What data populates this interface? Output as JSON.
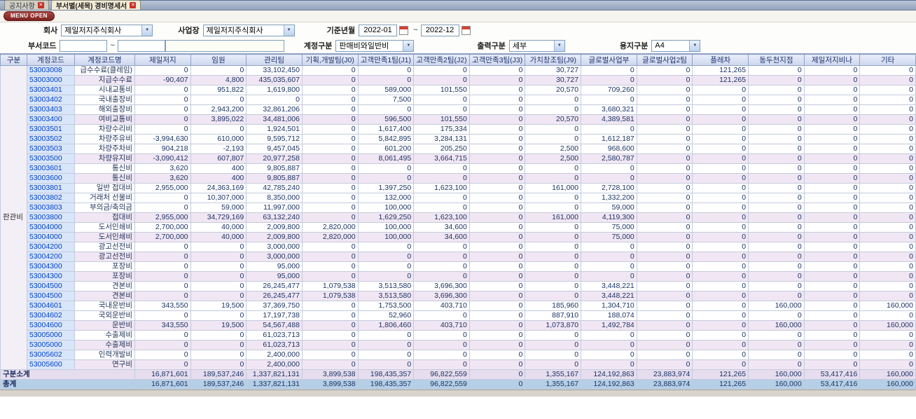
{
  "tabs": [
    {
      "label": "공지사항"
    },
    {
      "label": "부서별(세목) 경비명세서"
    }
  ],
  "menu_button": "MENU OPEN",
  "filters": {
    "company_label": "회사",
    "company_value": "제일저지주식회사",
    "workplace_label": "사업장",
    "workplace_value": "제일저지주식회사",
    "period_label": "기준년월",
    "period_from": "2022-01",
    "period_to": "2022-12",
    "tilde": "~",
    "dept_code_label": "부서코드",
    "dept_from": "",
    "dept_to": "",
    "dept_name": "",
    "account_label": "계정구분",
    "account_value": "판매비와일반비",
    "output_label": "출력구분",
    "output_value": "세부",
    "paper_label": "용지구분",
    "paper_value": "A4"
  },
  "table": {
    "group_label": "판관비",
    "columns": [
      "구분",
      "계정코드",
      "계정코드명",
      "제일저지",
      "임원",
      "관리팀",
      "기획,개발팀(J0)",
      "고객만족1팀(J1)",
      "고객만족2팀(J2)",
      "고객만족3팀(J3)",
      "가치창조팀(J9)",
      "글로벌사업부",
      "글로벌사업2팀",
      "플레차",
      "동두천지점",
      "제일저지비나",
      "기타"
    ],
    "rows": [
      {
        "code": "53003008",
        "name": "급수수료(클레임)",
        "type": "detail",
        "values": [
          "0",
          "0",
          "33,102,450",
          "0",
          "0",
          "0",
          "0",
          "30,727",
          "0",
          "0",
          "121,265",
          "0",
          "0",
          "0"
        ]
      },
      {
        "code": "53003000",
        "name": "지급수수료",
        "type": "subtotal",
        "values": [
          "-90,407",
          "4,800",
          "435,035,607",
          "0",
          "0",
          "0",
          "0",
          "30,727",
          "0",
          "0",
          "121,265",
          "0",
          "0",
          "0"
        ]
      },
      {
        "code": "53003401",
        "name": "시내교통비",
        "type": "detail",
        "values": [
          "0",
          "951,822",
          "1,619,800",
          "0",
          "589,000",
          "101,550",
          "0",
          "20,570",
          "709,260",
          "0",
          "0",
          "0",
          "0",
          "0"
        ]
      },
      {
        "code": "53003402",
        "name": "국내출장비",
        "type": "detail",
        "values": [
          "0",
          "0",
          "0",
          "0",
          "7,500",
          "0",
          "0",
          "0",
          "0",
          "0",
          "0",
          "0",
          "0",
          "0"
        ]
      },
      {
        "code": "53003403",
        "name": "해외출장비",
        "type": "detail",
        "values": [
          "0",
          "2,943,200",
          "32,861,206",
          "0",
          "0",
          "0",
          "0",
          "0",
          "3,680,321",
          "0",
          "0",
          "0",
          "0",
          "0"
        ]
      },
      {
        "code": "53003400",
        "name": "여비교통비",
        "type": "subtotal",
        "values": [
          "0",
          "3,895,022",
          "34,481,006",
          "0",
          "596,500",
          "101,550",
          "0",
          "20,570",
          "4,389,581",
          "0",
          "0",
          "0",
          "0",
          "0"
        ]
      },
      {
        "code": "53003501",
        "name": "차량수리비",
        "type": "detail",
        "values": [
          "0",
          "0",
          "1,924,501",
          "0",
          "1,617,400",
          "175,334",
          "0",
          "0",
          "0",
          "0",
          "0",
          "0",
          "0",
          "0"
        ]
      },
      {
        "code": "53003502",
        "name": "차량주유비",
        "type": "detail",
        "values": [
          "-3,994,630",
          "610,000",
          "9,595,712",
          "0",
          "5,842,895",
          "3,284,131",
          "0",
          "0",
          "1,612,187",
          "0",
          "0",
          "0",
          "0",
          "0"
        ]
      },
      {
        "code": "53003503",
        "name": "차량주차비",
        "type": "detail",
        "values": [
          "904,218",
          "-2,193",
          "9,457,045",
          "0",
          "601,200",
          "205,250",
          "0",
          "2,500",
          "968,600",
          "0",
          "0",
          "0",
          "0",
          "0"
        ]
      },
      {
        "code": "53003500",
        "name": "차량유지비",
        "type": "subtotal",
        "values": [
          "-3,090,412",
          "607,807",
          "20,977,258",
          "0",
          "8,061,495",
          "3,664,715",
          "0",
          "2,500",
          "2,580,787",
          "0",
          "0",
          "0",
          "0",
          "0"
        ]
      },
      {
        "code": "53003601",
        "name": "통신비",
        "type": "detail",
        "values": [
          "3,620",
          "400",
          "9,805,887",
          "0",
          "0",
          "0",
          "0",
          "0",
          "0",
          "0",
          "0",
          "0",
          "0",
          "0"
        ]
      },
      {
        "code": "53003600",
        "name": "통신비",
        "type": "subtotal",
        "values": [
          "3,620",
          "400",
          "9,805,887",
          "0",
          "0",
          "0",
          "0",
          "0",
          "0",
          "0",
          "0",
          "0",
          "0",
          "0"
        ]
      },
      {
        "code": "53003801",
        "name": "일반 접대비",
        "type": "detail",
        "values": [
          "2,955,000",
          "24,363,169",
          "42,785,240",
          "0",
          "1,397,250",
          "1,623,100",
          "0",
          "161,000",
          "2,728,100",
          "0",
          "0",
          "0",
          "0",
          "0"
        ]
      },
      {
        "code": "53003802",
        "name": "거래처 선물비",
        "type": "detail",
        "values": [
          "0",
          "10,307,000",
          "8,350,000",
          "0",
          "132,000",
          "0",
          "0",
          "0",
          "1,332,200",
          "0",
          "0",
          "0",
          "0",
          "0"
        ]
      },
      {
        "code": "53003803",
        "name": "부의금/축의금",
        "type": "detail",
        "values": [
          "0",
          "59,000",
          "11,997,000",
          "0",
          "100,000",
          "0",
          "0",
          "0",
          "59,000",
          "0",
          "0",
          "0",
          "0",
          "0"
        ]
      },
      {
        "code": "53003800",
        "name": "접대비",
        "type": "subtotal",
        "values": [
          "2,955,000",
          "34,729,169",
          "63,132,240",
          "0",
          "1,629,250",
          "1,623,100",
          "0",
          "161,000",
          "4,119,300",
          "0",
          "0",
          "0",
          "0",
          "0"
        ]
      },
      {
        "code": "53004000",
        "name": "도서인쇄비",
        "type": "detail",
        "values": [
          "2,700,000",
          "40,000",
          "2,009,800",
          "2,820,000",
          "100,000",
          "34,600",
          "0",
          "0",
          "75,000",
          "0",
          "0",
          "0",
          "0",
          "0"
        ]
      },
      {
        "code": "53004000",
        "name": "도서인쇄비",
        "type": "subtotal",
        "values": [
          "2,700,000",
          "40,000",
          "2,009,800",
          "2,820,000",
          "100,000",
          "34,600",
          "0",
          "0",
          "75,000",
          "0",
          "0",
          "0",
          "0",
          "0"
        ]
      },
      {
        "code": "53004200",
        "name": "광고선전비",
        "type": "detail",
        "values": [
          "0",
          "0",
          "3,000,000",
          "0",
          "0",
          "0",
          "0",
          "0",
          "0",
          "0",
          "0",
          "0",
          "0",
          "0"
        ]
      },
      {
        "code": "53004200",
        "name": "광고선전비",
        "type": "subtotal",
        "values": [
          "0",
          "0",
          "3,000,000",
          "0",
          "0",
          "0",
          "0",
          "0",
          "0",
          "0",
          "0",
          "0",
          "0",
          "0"
        ]
      },
      {
        "code": "53004300",
        "name": "포장비",
        "type": "detail",
        "values": [
          "0",
          "0",
          "95,000",
          "0",
          "0",
          "0",
          "0",
          "0",
          "0",
          "0",
          "0",
          "0",
          "0",
          "0"
        ]
      },
      {
        "code": "53004300",
        "name": "포장비",
        "type": "subtotal",
        "values": [
          "0",
          "0",
          "95,000",
          "0",
          "0",
          "0",
          "0",
          "0",
          "0",
          "0",
          "0",
          "0",
          "0",
          "0"
        ]
      },
      {
        "code": "53004500",
        "name": "견본비",
        "type": "detail",
        "values": [
          "0",
          "0",
          "26,245,477",
          "1,079,538",
          "3,513,580",
          "3,696,300",
          "0",
          "0",
          "3,448,221",
          "0",
          "0",
          "0",
          "0",
          "0"
        ]
      },
      {
        "code": "53004500",
        "name": "견본비",
        "type": "subtotal",
        "values": [
          "0",
          "0",
          "26,245,477",
          "1,079,538",
          "3,513,580",
          "3,696,300",
          "0",
          "0",
          "3,448,221",
          "0",
          "0",
          "0",
          "0",
          "0"
        ]
      },
      {
        "code": "53004601",
        "name": "국내운반비",
        "type": "detail",
        "values": [
          "343,550",
          "19,500",
          "37,369,750",
          "0",
          "1,753,500",
          "403,710",
          "0",
          "185,960",
          "1,304,710",
          "0",
          "0",
          "160,000",
          "0",
          "160,000"
        ]
      },
      {
        "code": "53004602",
        "name": "국외운반비",
        "type": "detail",
        "values": [
          "0",
          "0",
          "17,197,738",
          "0",
          "52,960",
          "0",
          "0",
          "887,910",
          "188,074",
          "0",
          "0",
          "0",
          "0",
          "0"
        ]
      },
      {
        "code": "53004600",
        "name": "운반비",
        "type": "subtotal",
        "values": [
          "343,550",
          "19,500",
          "54,567,488",
          "0",
          "1,806,460",
          "403,710",
          "0",
          "1,073,870",
          "1,492,784",
          "0",
          "0",
          "160,000",
          "0",
          "160,000"
        ]
      },
      {
        "code": "53005000",
        "name": "수출제비",
        "type": "detail",
        "values": [
          "0",
          "0",
          "61,023,713",
          "0",
          "0",
          "0",
          "0",
          "0",
          "0",
          "0",
          "0",
          "0",
          "0",
          "0"
        ]
      },
      {
        "code": "53005000",
        "name": "수출제비",
        "type": "subtotal",
        "values": [
          "0",
          "0",
          "61,023,713",
          "0",
          "0",
          "0",
          "0",
          "0",
          "0",
          "0",
          "0",
          "0",
          "0",
          "0"
        ]
      },
      {
        "code": "53005602",
        "name": "인력개발비",
        "type": "detail",
        "values": [
          "0",
          "0",
          "2,400,000",
          "0",
          "0",
          "0",
          "0",
          "0",
          "0",
          "0",
          "0",
          "0",
          "0",
          "0"
        ]
      },
      {
        "code": "53005600",
        "name": "연구비",
        "type": "subtotal",
        "values": [
          "0",
          "0",
          "2,400,000",
          "0",
          "0",
          "0",
          "0",
          "0",
          "0",
          "0",
          "0",
          "0",
          "0",
          "0"
        ]
      }
    ],
    "footer_rows": [
      {
        "label": "구분소계",
        "type": "section-total",
        "values": [
          "16,871,601",
          "189,537,246",
          "1,337,821,131",
          "3,899,538",
          "198,435,357",
          "96,822,559",
          "0",
          "1,355,167",
          "124,192,863",
          "23,883,974",
          "121,265",
          "160,000",
          "53,417,416",
          "160,000"
        ]
      },
      {
        "label": "총계",
        "type": "grand-total",
        "values": [
          "16,871,601",
          "189,537,246",
          "1,337,821,131",
          "3,899,538",
          "198,435,357",
          "96,822,559",
          "0",
          "1,355,167",
          "124,192,863",
          "23,883,974",
          "121,265",
          "160,000",
          "53,417,416",
          "160,000"
        ]
      }
    ]
  }
}
